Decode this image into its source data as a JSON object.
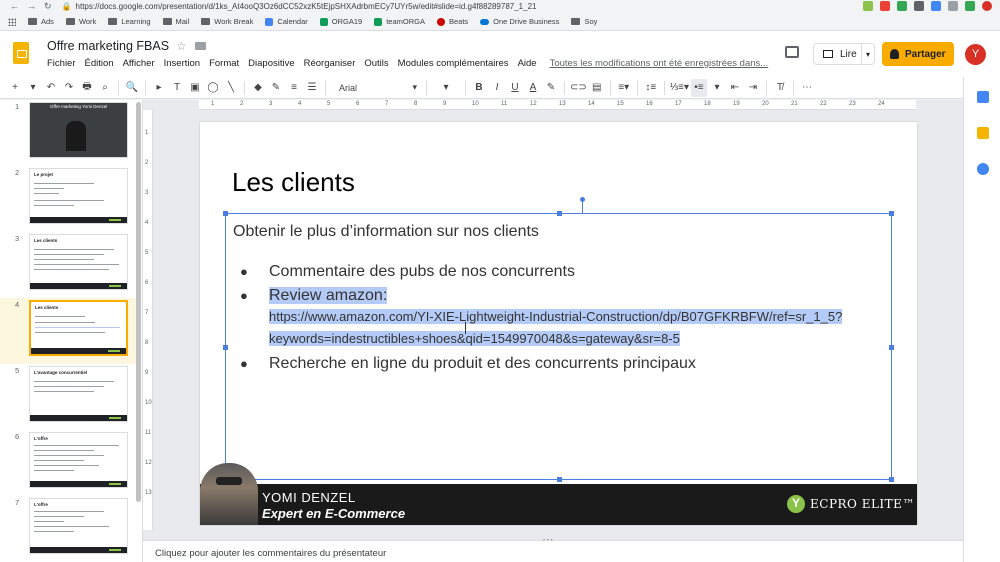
{
  "browser": {
    "url": "https://docs.google.com/presentation/d/1ks_At4ooQ3Oz6dCC52xzK5tEjpSHXAdrbmECy7UYr5w/edit#slide=id.g4f88289787_1_21",
    "bookmarks": [
      "Ads",
      "Work",
      "Learning",
      "Mail",
      "Work Break",
      "Calendar",
      "ORGA19",
      "teamORGA",
      "Beats",
      "One Drive Business",
      "Soy"
    ]
  },
  "doc": {
    "title": "Offre marketing FBAS",
    "menus": [
      "Fichier",
      "Édition",
      "Afficher",
      "Insertion",
      "Format",
      "Diapositive",
      "Réorganiser",
      "Outils",
      "Modules complémentaires",
      "Aide"
    ],
    "saved_status": "Toutes les modifications ont été enregistrées dans...",
    "present_label": "Lire",
    "share_label": "Partager",
    "avatar_initial": "Y"
  },
  "toolbar": {
    "font": "Arial",
    "buttons": [
      "+",
      "↶",
      "↷",
      "🖶",
      "⌕",
      "🔍",
      "▸",
      "T",
      "▣",
      "◯",
      "╲",
      "◆",
      "✎",
      "≡",
      "☰"
    ],
    "format": [
      "B",
      "I",
      "U",
      "A"
    ]
  },
  "filmstrip": {
    "numbers": [
      "1",
      "2",
      "3",
      "4",
      "5",
      "6",
      "7"
    ],
    "titles": [
      "Offre marketing Yomi Denzel",
      "Le projet",
      "Les clients",
      "Les clients",
      "L'avantage concurrentiel",
      "L'offre",
      "L'offre"
    ]
  },
  "ruler": {
    "h": [
      "1",
      "2",
      "3",
      "4",
      "5",
      "6",
      "7",
      "8",
      "9",
      "10",
      "11",
      "12",
      "13",
      "14",
      "15",
      "16",
      "17",
      "18",
      "19",
      "20",
      "21",
      "22",
      "23",
      "24"
    ],
    "v": [
      "1",
      "2",
      "3",
      "4",
      "5",
      "6",
      "7",
      "8",
      "9",
      "10",
      "11",
      "12",
      "13"
    ]
  },
  "slide": {
    "title": "Les clients",
    "intro": "Obtenir le plus d’information sur nos clients",
    "bullet1": "Commentaire des pubs de nos concurrents",
    "bullet2_label": "Review amazon:",
    "bullet2_url1": "https://www.amazon.com/YI-XIE-Lightweight-Industrial-Construction/dp/B07GFKRBFW/ref=sr_1_5?",
    "bullet2_url2": "keywords=indestructibles+shoes&qid=1549970048&s=gateway&sr=8-5",
    "bullet3": "Recherche en ligne du produit et des concurrents principaux",
    "presenter_name": "YOMI DENZEL",
    "presenter_role": "Expert en E-Commerce",
    "brand": "ECPRO ELITE™"
  },
  "notes": {
    "placeholder": "Cliquez pour ajouter les commentaires du présentateur"
  },
  "colors": {
    "accent": "#f9ab00",
    "selection": "#4a7ee0",
    "highlight": "#b5cbf7"
  }
}
